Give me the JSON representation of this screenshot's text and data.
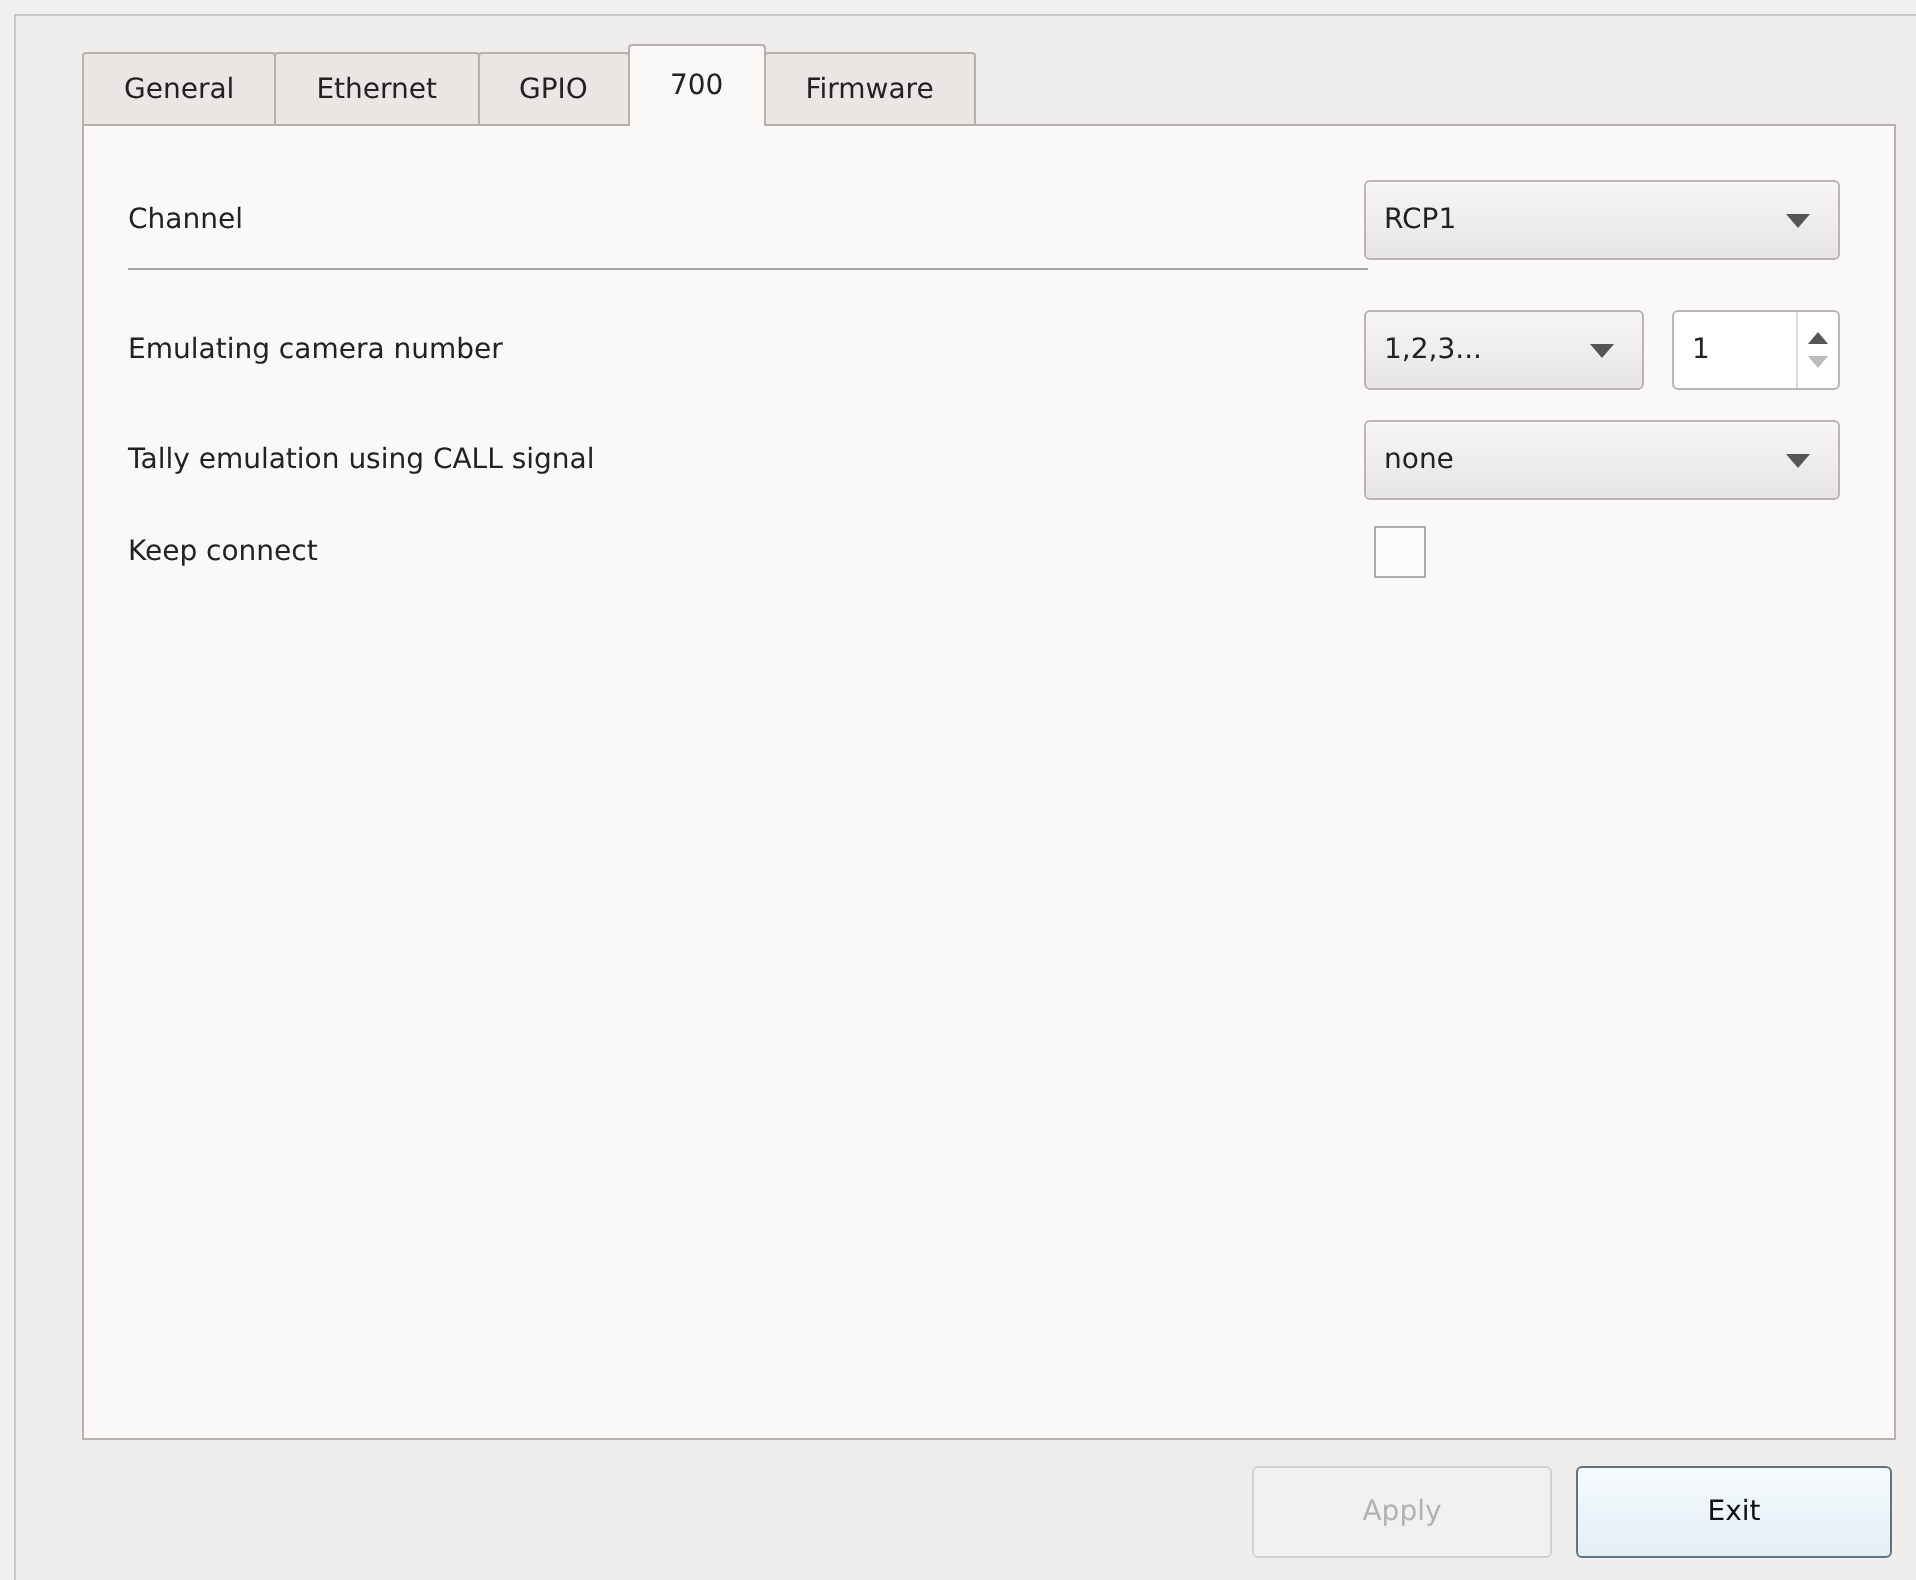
{
  "tabs": [
    {
      "label": "General",
      "selected": false
    },
    {
      "label": "Ethernet",
      "selected": false
    },
    {
      "label": "GPIO",
      "selected": false
    },
    {
      "label": "700",
      "selected": true
    },
    {
      "label": "Firmware",
      "selected": false
    }
  ],
  "settings": [
    {
      "kind": "combo",
      "label": "Channel",
      "value": "RCP1",
      "separator_below": true
    },
    {
      "kind": "combo_spin",
      "label": "Emulating camera number",
      "value": "1,2,3...",
      "spin_value": "1"
    },
    {
      "kind": "combo",
      "label": "Tally emulation using CALL signal",
      "value": "none"
    },
    {
      "kind": "checkbox",
      "label": "Keep connect",
      "checked": false
    }
  ],
  "buttons": [
    {
      "label": "Apply",
      "disabled": true
    },
    {
      "label": "Exit",
      "disabled": false
    }
  ]
}
